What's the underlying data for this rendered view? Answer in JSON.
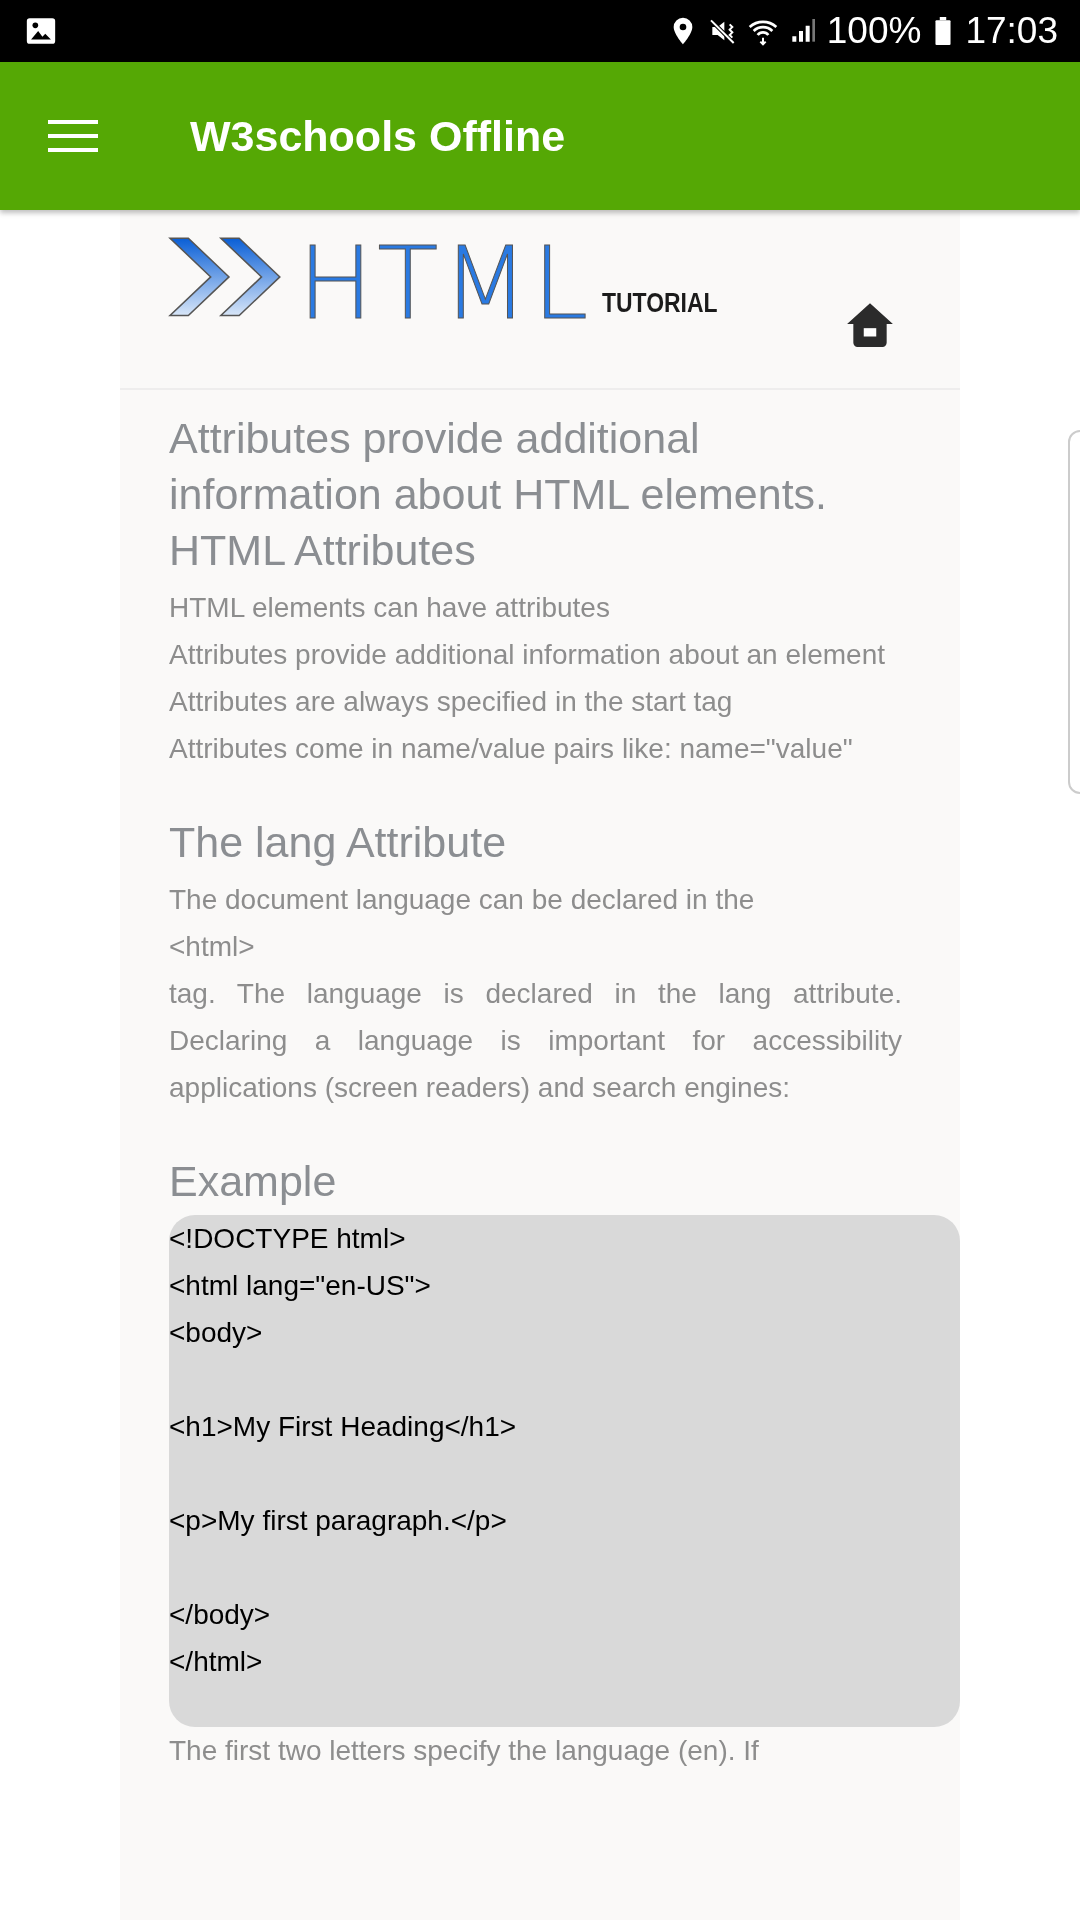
{
  "status_bar": {
    "battery": "100%",
    "time": "17:03"
  },
  "app_bar": {
    "title": "W3schools Offline"
  },
  "logo": {
    "title": "HTML",
    "subtitle": "TUTORIAL"
  },
  "sections": [
    {
      "kind": "heading",
      "lines": [
        "Attributes provide additional information about HTML elements.",
        "HTML Attributes"
      ]
    },
    {
      "kind": "paragraph",
      "lines": [
        "HTML elements can have attributes",
        "Attributes provide additional information about an element",
        "Attributes are always specified in the start tag",
        "Attributes come in name/value pairs like: name=\"value\""
      ]
    },
    {
      "kind": "heading",
      "lines": [
        "The lang Attribute"
      ]
    },
    {
      "kind": "paragraph",
      "lines": [
        "The document language can be declared in the",
        "<html>",
        "tag. The language is declared in the lang attribute. Declaring a language is important for accessibility applications (screen readers) and search engines:"
      ]
    },
    {
      "kind": "heading",
      "lines": [
        "Example"
      ]
    },
    {
      "kind": "code",
      "groups": [
        [
          "<!DOCTYPE html>",
          "<html lang=\"en-US\">",
          "<body>"
        ],
        [
          "<h1>My First Heading</h1>"
        ],
        [
          "<p>My first paragraph.</p>"
        ],
        [
          "</body>",
          "</html>"
        ]
      ]
    },
    {
      "kind": "paragraph",
      "lines": [
        "The first two letters specify the language (en). If"
      ]
    }
  ]
}
